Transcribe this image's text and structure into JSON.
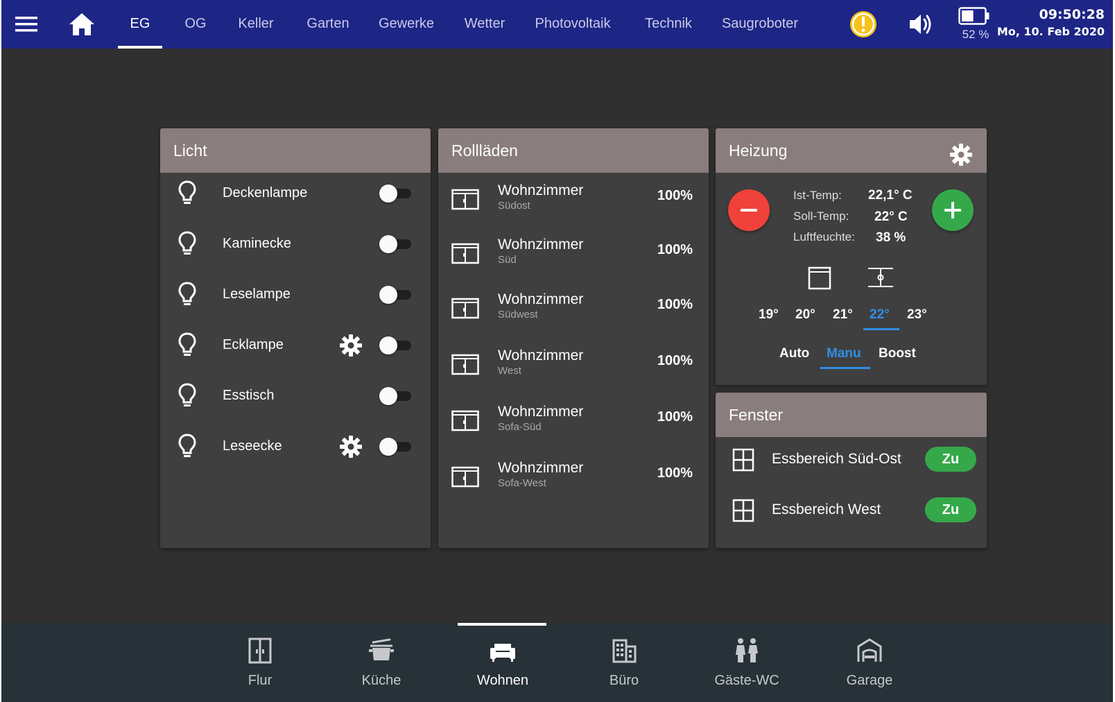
{
  "topbar": {
    "menu_icon": "menu-icon",
    "home_icon": "home-icon",
    "tabs": [
      {
        "label": "EG",
        "active": true
      },
      {
        "label": "OG"
      },
      {
        "label": "Keller"
      },
      {
        "label": "Garten"
      },
      {
        "label": "Gewerke"
      },
      {
        "label": "Wetter"
      },
      {
        "label": "Photovoltaik"
      },
      {
        "label": "Technik"
      },
      {
        "label": "Saugroboter"
      }
    ],
    "alert_icon": "alert-icon",
    "alert_color": "#f6c31c",
    "sound_icon": "speaker-icon",
    "battery_icon": "battery-icon",
    "battery_percent": "52 %",
    "battery_level": 0.52,
    "time": "09:50:28",
    "date": "Mo, 10. Feb 2020",
    "bar_color": "#1d2685"
  },
  "licht": {
    "title": "Licht",
    "items": [
      {
        "label": "Deckenlampe",
        "on": false,
        "has_settings": false
      },
      {
        "label": "Kaminecke",
        "on": false,
        "has_settings": false
      },
      {
        "label": "Leselampe",
        "on": false,
        "has_settings": false
      },
      {
        "label": "Ecklampe",
        "on": false,
        "has_settings": true
      },
      {
        "label": "Esstisch",
        "on": false,
        "has_settings": false
      },
      {
        "label": "Leseecke",
        "on": false,
        "has_settings": true
      }
    ]
  },
  "rolllaeden": {
    "title": "Rollläden",
    "items": [
      {
        "name": "Wohnzimmer",
        "sub": "Südost",
        "value": "100%"
      },
      {
        "name": "Wohnzimmer",
        "sub": "Süd",
        "value": "100%"
      },
      {
        "name": "Wohnzimmer",
        "sub": "Südwest",
        "value": "100%"
      },
      {
        "name": "Wohnzimmer",
        "sub": "West",
        "value": "100%"
      },
      {
        "name": "Wohnzimmer",
        "sub": "Sofa-Süd",
        "value": "100%"
      },
      {
        "name": "Wohnzimmer",
        "sub": "Sofa-West",
        "value": "100%"
      }
    ]
  },
  "heizung": {
    "title": "Heizung",
    "settings_icon": "gear-icon",
    "ist_label": "Ist-Temp:",
    "ist_value": "22,1° C",
    "soll_label": "Soll-Temp:",
    "soll_value": "22° C",
    "feuchte_label": "Luftfeuchte:",
    "feuchte_value": "38 %",
    "temps": [
      "19°",
      "20°",
      "21°",
      "22°",
      "23°"
    ],
    "selected_temp": "22°",
    "modes": [
      "Auto",
      "Manu",
      "Boost"
    ],
    "selected_mode": "Manu",
    "minus_color": "#f0413a",
    "plus_color": "#35a94a",
    "accent": "#2f8fe5"
  },
  "fenster": {
    "title": "Fenster",
    "items": [
      {
        "label": "Essbereich Süd-Ost",
        "status": "Zu"
      },
      {
        "label": "Essbereich West",
        "status": "Zu"
      }
    ]
  },
  "rooms": [
    {
      "label": "Flur",
      "icon": "door-icon"
    },
    {
      "label": "Küche",
      "icon": "pot-icon"
    },
    {
      "label": "Wohnen",
      "icon": "sofa-icon",
      "active": true
    },
    {
      "label": "Büro",
      "icon": "office-building-icon"
    },
    {
      "label": "Gäste-WC",
      "icon": "restroom-icon"
    },
    {
      "label": "Garage",
      "icon": "garage-icon"
    }
  ]
}
